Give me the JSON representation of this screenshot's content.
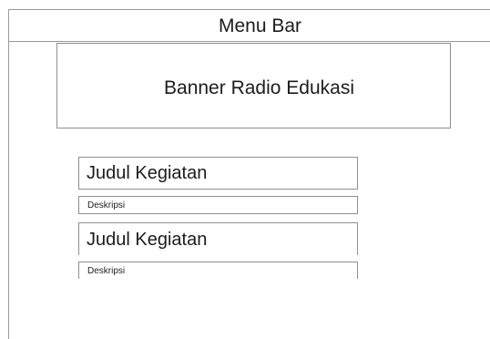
{
  "menu_bar": {
    "label": "Menu Bar"
  },
  "banner": {
    "label": "Banner Radio Edukasi"
  },
  "activities": [
    {
      "title": "Judul Kegiatan",
      "description": "Deskripsi"
    },
    {
      "title": "Judul Kegiatan",
      "description": "Deskripsi"
    }
  ]
}
